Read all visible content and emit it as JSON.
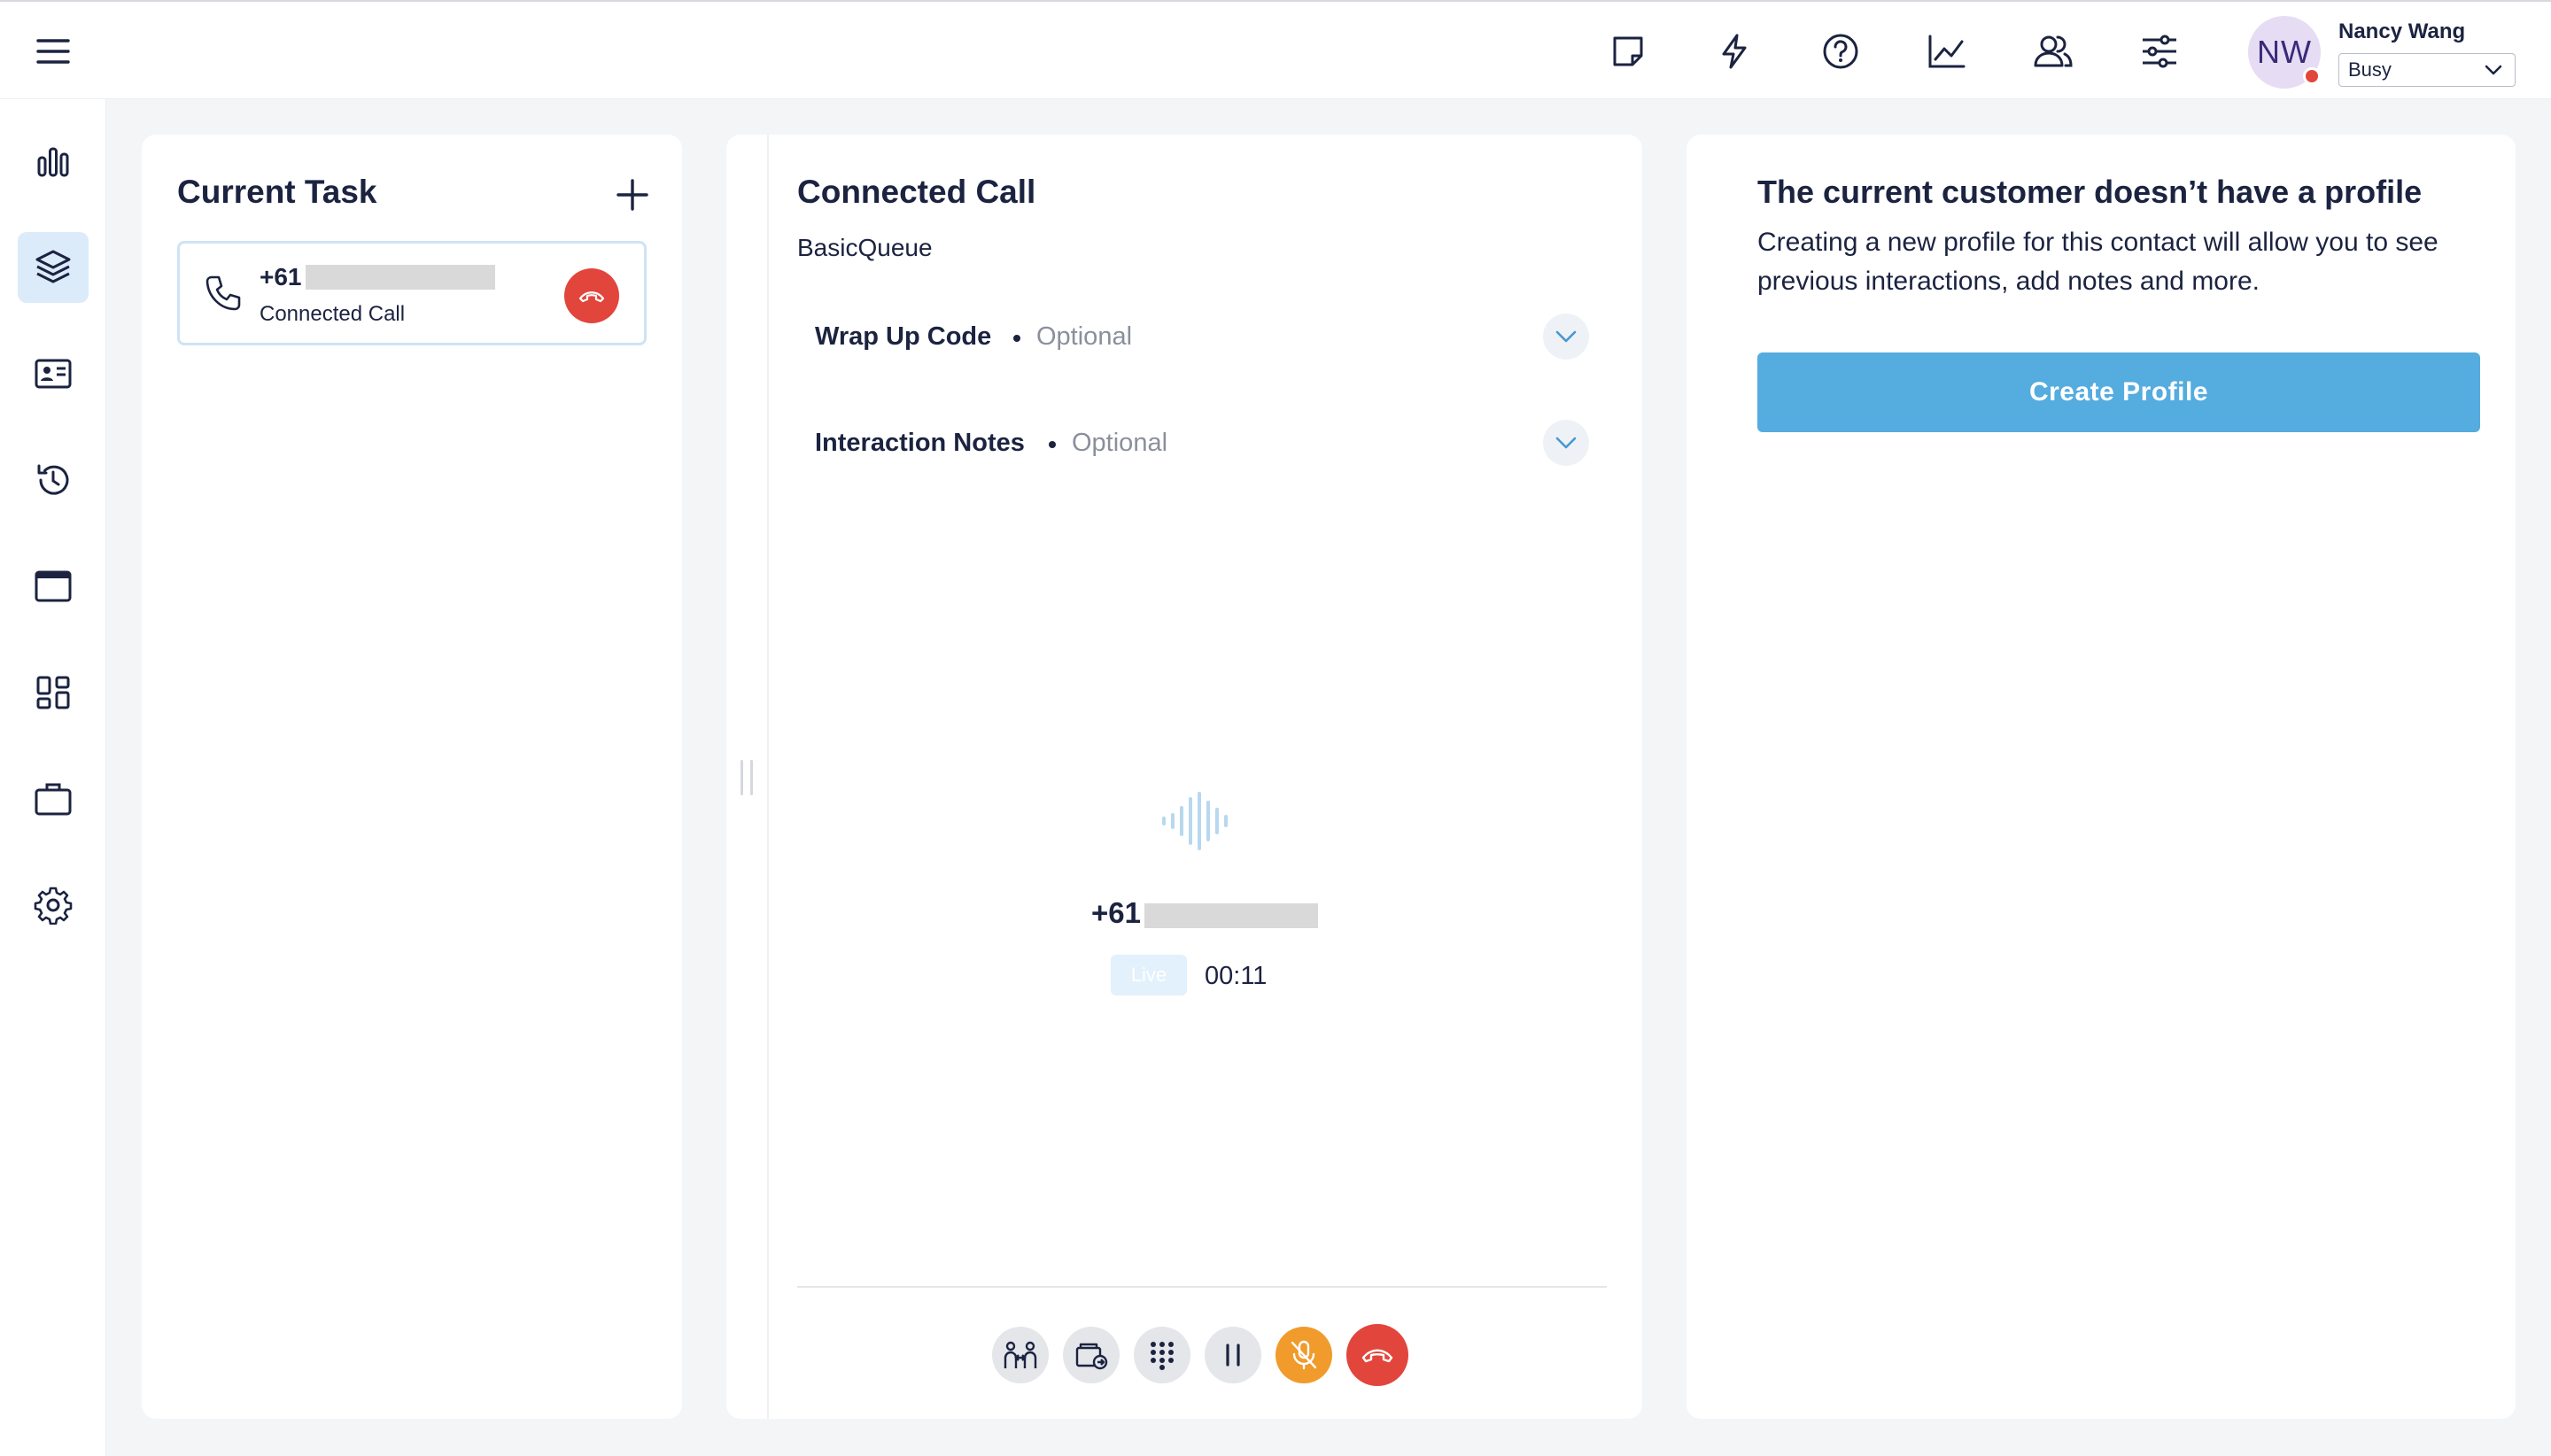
{
  "topbar": {
    "menu_icon": "hamburger-menu-icon",
    "icons": [
      "notes-icon",
      "lightning-icon",
      "help-icon",
      "analytics-icon",
      "contacts-icon",
      "settings-sliders-icon"
    ],
    "user": {
      "initials": "NW",
      "name": "Nancy Wang",
      "status": "Busy",
      "status_color": "#e2453c"
    }
  },
  "sidebar": {
    "items": [
      {
        "icon": "bar-chart-icon",
        "active": false
      },
      {
        "icon": "layers-icon",
        "active": true
      },
      {
        "icon": "contact-card-icon",
        "active": false
      },
      {
        "icon": "history-icon",
        "active": false
      },
      {
        "icon": "window-icon",
        "active": false
      },
      {
        "icon": "apps-grid-icon",
        "active": false
      },
      {
        "icon": "briefcase-icon",
        "active": false
      },
      {
        "icon": "gear-icon",
        "active": false
      }
    ]
  },
  "current_task": {
    "title": "Current Task",
    "task": {
      "number_prefix": "+61",
      "label": "Connected Call"
    }
  },
  "connected_call": {
    "title": "Connected Call",
    "queue": "BasicQueue",
    "wrap_up": {
      "label": "Wrap Up Code",
      "hint": "Optional"
    },
    "notes": {
      "label": "Interaction Notes",
      "hint": "Optional"
    },
    "caller_prefix": "+61",
    "live_label": "Live",
    "timer": "00:11",
    "controls": [
      "consult-icon",
      "transfer-icon",
      "keypad-icon",
      "hold-icon",
      "mute-icon",
      "hangup-icon"
    ]
  },
  "profile": {
    "title": "The current customer doesn’t have a profile",
    "description": "Creating a new profile for this contact will allow you to see previous interactions, add notes and more.",
    "button": "Create Profile"
  },
  "colors": {
    "accent": "#54acdf",
    "danger": "#e2453c",
    "warning": "#f09b2b",
    "active_bg": "#dcebfa"
  }
}
